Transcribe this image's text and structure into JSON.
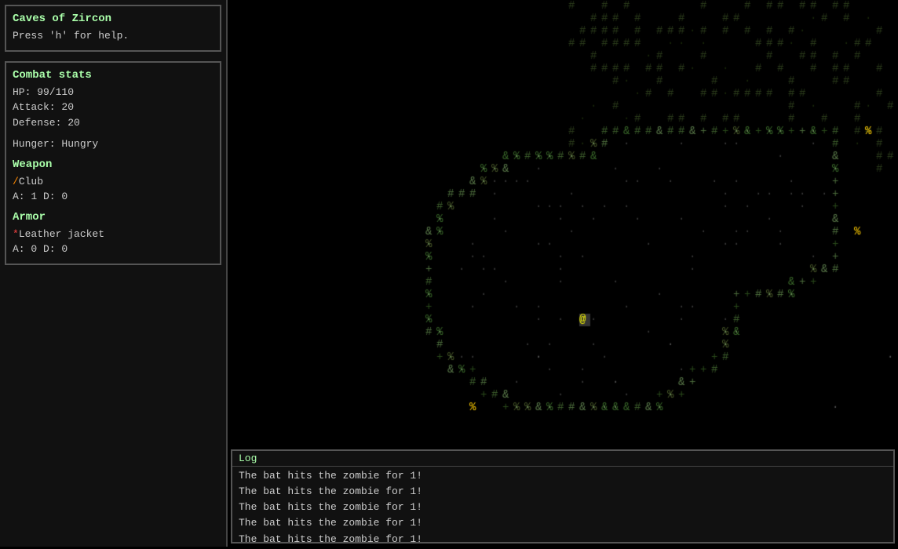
{
  "sidebar": {
    "title_panel": {
      "title": "Caves of Zircon",
      "help_text": "Press 'h' for help."
    },
    "combat_panel": {
      "title": "Combat stats",
      "hp_label": "HP:",
      "hp_current": "99",
      "hp_max": "110",
      "hp_display": "HP:  99/110",
      "attack_label": "Attack:",
      "attack_value": "20",
      "attack_display": "Attack: 20",
      "defense_label": "Defense:",
      "defense_value": "20",
      "defense_display": "Defense: 20",
      "hunger_label": "Hunger:",
      "hunger_status": "Hungry",
      "hunger_display": "Hunger: Hungry",
      "weapon_label": "Weapon",
      "weapon_name": "Club",
      "weapon_icon": "/",
      "weapon_stats": "A:  1 D:  0",
      "armor_label": "Armor",
      "armor_name": "Leather jacket",
      "armor_icon": "*",
      "armor_stats": "A:  0 D:  0"
    }
  },
  "log": {
    "title": "Log",
    "entries": [
      "The bat hits the zombie for 1!",
      "The bat hits the zombie for 1!",
      "The bat hits the zombie for 1!",
      "The bat hits the zombie for 1!",
      "The bat hits the zombie for 1!"
    ]
  },
  "map": {
    "player_char": "@",
    "enemy_char": "%"
  },
  "colors": {
    "background": "#000000",
    "sidebar_bg": "#111111",
    "panel_border": "#555555",
    "text_normal": "#cccccc",
    "text_green": "#aaffaa",
    "text_yellow": "#ffff00",
    "text_orange": "#ff8800",
    "text_red": "#ff4444",
    "wall_green": "#4a7a3a",
    "wall_dark": "#2a4a1a",
    "floor_dark": "#222222",
    "floor_medium": "#333333"
  }
}
